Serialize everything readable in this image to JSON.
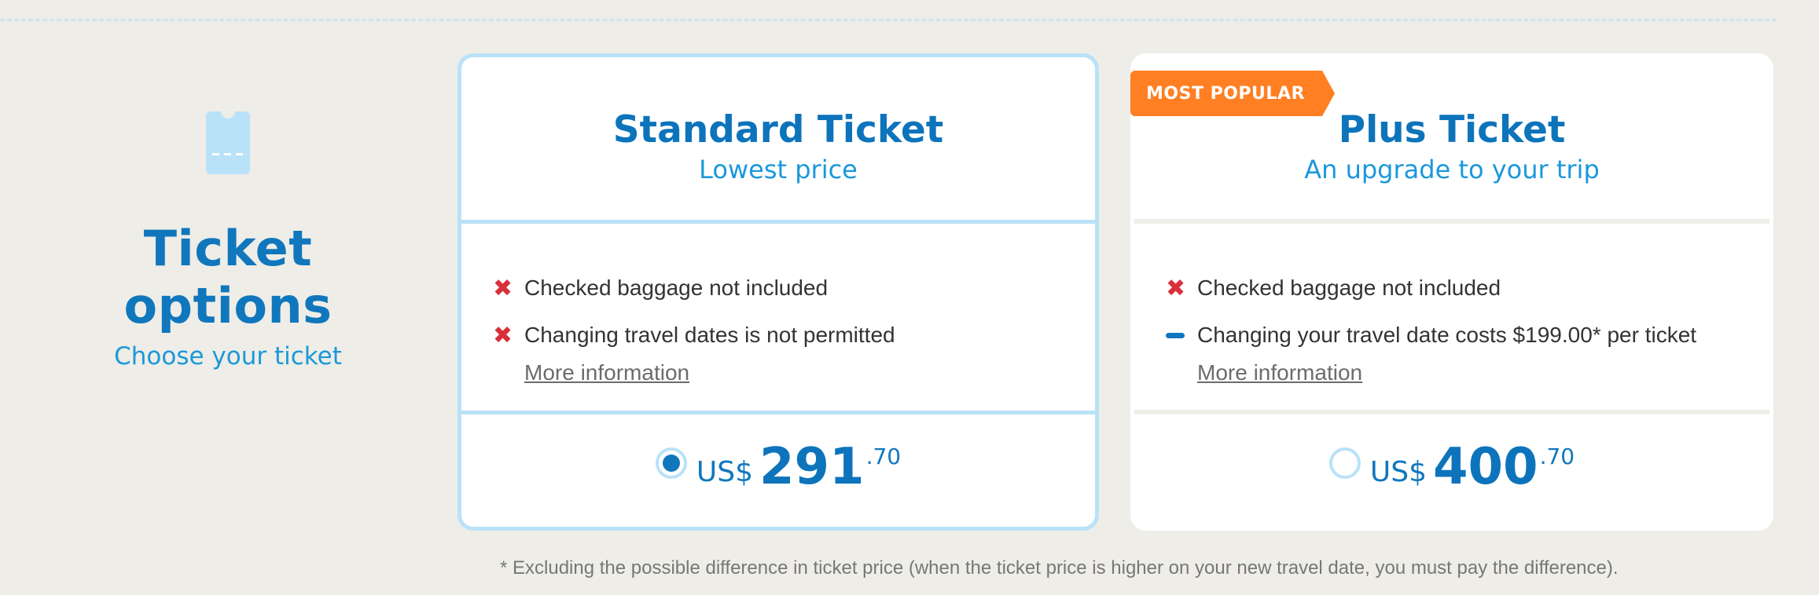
{
  "intro": {
    "icon": "ticket-icon",
    "title": "Ticket options",
    "subtitle": "Choose your ticket"
  },
  "cards": [
    {
      "title": "Standard Ticket",
      "subtitle": "Lowest price",
      "selected": true,
      "features": [
        {
          "icon": "cross-icon",
          "text": "Checked baggage not included"
        },
        {
          "icon": "cross-icon",
          "text": "Changing travel dates is not permitted"
        }
      ],
      "more_link": "More information",
      "price": {
        "currency": "US$",
        "amount": "291",
        "cents": ".70"
      }
    },
    {
      "badge": "MOST POPULAR",
      "title": "Plus Ticket",
      "subtitle": "An upgrade to your trip",
      "selected": false,
      "features": [
        {
          "icon": "cross-icon",
          "text": "Checked baggage not included"
        },
        {
          "icon": "dash-icon",
          "text": "Changing your travel date costs $199.00* per ticket"
        }
      ],
      "more_link": "More information",
      "price": {
        "currency": "US$",
        "amount": "400",
        "cents": ".70"
      }
    }
  ],
  "footnote": "* Excluding the possible difference in ticket price (when the ticket price is higher on your new travel date, you must pay the difference).",
  "colors": {
    "background": "#eeede7",
    "primary_blue": "#1077bd",
    "light_blue": "#1b98da",
    "selected_border": "#b9e2f9",
    "badge_orange": "#ff7f22",
    "cross_red": "#d8303a"
  }
}
